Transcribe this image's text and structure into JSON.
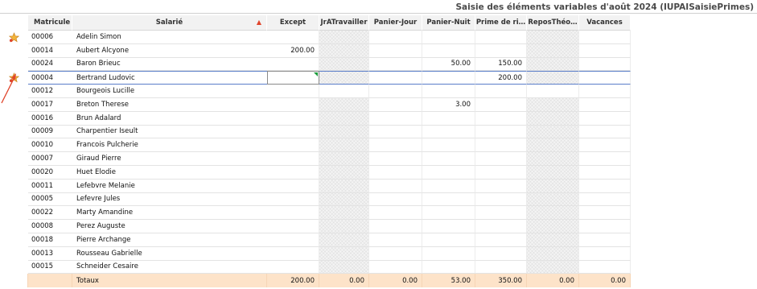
{
  "page": {
    "title": "Saisie des éléments variables d'août 2024 (IUPAISaisiePrimes)"
  },
  "colors": {
    "header_bg": "#f2f2f2",
    "totals_bg": "#fde3c9",
    "selection_border": "#5b7ec9",
    "hatch_bg": "#f4f4f4",
    "arrow": "#e0452b",
    "star": "#f2b43c"
  },
  "columns": {
    "matricule": "Matricule",
    "salarie": "Salarié",
    "sort_indicator": "▲",
    "except": "Except",
    "jr_a_travailler": "JrATravailler",
    "panier_jour": "Panier-Jour",
    "panier_nuit": "Panier-Nuit",
    "prime_de_ri": "Prime de ri…",
    "repos_theo": "ReposThéo…",
    "vacances": "Vacances"
  },
  "rows": [
    {
      "matricule": "00006",
      "salarie": "Adelin Simon",
      "except": "",
      "jr": "",
      "pj": "",
      "pn": "",
      "prime": "",
      "repos": "",
      "vac": "",
      "icon": "star-icon"
    },
    {
      "matricule": "00014",
      "salarie": "Aubert Alcyone",
      "except": "200.00",
      "jr": "",
      "pj": "",
      "pn": "",
      "prime": "",
      "repos": "",
      "vac": "",
      "icon": ""
    },
    {
      "matricule": "00024",
      "salarie": "Baron Brieuc",
      "except": "",
      "jr": "",
      "pj": "",
      "pn": "50.00",
      "prime": "150.00",
      "repos": "",
      "vac": "",
      "icon": ""
    },
    {
      "matricule": "00004",
      "salarie": "Bertrand Ludovic",
      "except": "",
      "jr": "",
      "pj": "",
      "pn": "",
      "prime": "200.00",
      "repos": "",
      "vac": "",
      "icon": "star-icon"
    },
    {
      "matricule": "00012",
      "salarie": "Bourgeois Lucille",
      "except": "",
      "jr": "",
      "pj": "",
      "pn": "",
      "prime": "",
      "repos": "",
      "vac": "",
      "icon": ""
    },
    {
      "matricule": "00017",
      "salarie": "Breton Therese",
      "except": "",
      "jr": "",
      "pj": "",
      "pn": "3.00",
      "prime": "",
      "repos": "",
      "vac": "",
      "icon": ""
    },
    {
      "matricule": "00016",
      "salarie": "Brun Adalard",
      "except": "",
      "jr": "",
      "pj": "",
      "pn": "",
      "prime": "",
      "repos": "",
      "vac": "",
      "icon": ""
    },
    {
      "matricule": "00009",
      "salarie": "Charpentier Iseult",
      "except": "",
      "jr": "",
      "pj": "",
      "pn": "",
      "prime": "",
      "repos": "",
      "vac": "",
      "icon": ""
    },
    {
      "matricule": "00010",
      "salarie": "Francois Pulcherie",
      "except": "",
      "jr": "",
      "pj": "",
      "pn": "",
      "prime": "",
      "repos": "",
      "vac": "",
      "icon": ""
    },
    {
      "matricule": "00007",
      "salarie": "Giraud Pierre",
      "except": "",
      "jr": "",
      "pj": "",
      "pn": "",
      "prime": "",
      "repos": "",
      "vac": "",
      "icon": ""
    },
    {
      "matricule": "00020",
      "salarie": "Huet Elodie",
      "except": "",
      "jr": "",
      "pj": "",
      "pn": "",
      "prime": "",
      "repos": "",
      "vac": "",
      "icon": ""
    },
    {
      "matricule": "00011",
      "salarie": "Lefebvre Melanie",
      "except": "",
      "jr": "",
      "pj": "",
      "pn": "",
      "prime": "",
      "repos": "",
      "vac": "",
      "icon": ""
    },
    {
      "matricule": "00005",
      "salarie": "Lefevre Jules",
      "except": "",
      "jr": "",
      "pj": "",
      "pn": "",
      "prime": "",
      "repos": "",
      "vac": "",
      "icon": ""
    },
    {
      "matricule": "00022",
      "salarie": "Marty Amandine",
      "except": "",
      "jr": "",
      "pj": "",
      "pn": "",
      "prime": "",
      "repos": "",
      "vac": "",
      "icon": ""
    },
    {
      "matricule": "00008",
      "salarie": "Perez Auguste",
      "except": "",
      "jr": "",
      "pj": "",
      "pn": "",
      "prime": "",
      "repos": "",
      "vac": "",
      "icon": ""
    },
    {
      "matricule": "00018",
      "salarie": "Pierre Archange",
      "except": "",
      "jr": "",
      "pj": "",
      "pn": "",
      "prime": "",
      "repos": "",
      "vac": "",
      "icon": ""
    },
    {
      "matricule": "00013",
      "salarie": "Rousseau Gabrielle",
      "except": "",
      "jr": "",
      "pj": "",
      "pn": "",
      "prime": "",
      "repos": "",
      "vac": "",
      "icon": ""
    },
    {
      "matricule": "00015",
      "salarie": "Schneider Cesaire",
      "except": "",
      "jr": "",
      "pj": "",
      "pn": "",
      "prime": "",
      "repos": "",
      "vac": "",
      "icon": ""
    }
  ],
  "totals": {
    "label": "Totaux",
    "except": "200.00",
    "jr": "0.00",
    "pj": "0.00",
    "pn": "53.00",
    "prime": "350.00",
    "repos": "0.00",
    "vac": "0.00"
  }
}
